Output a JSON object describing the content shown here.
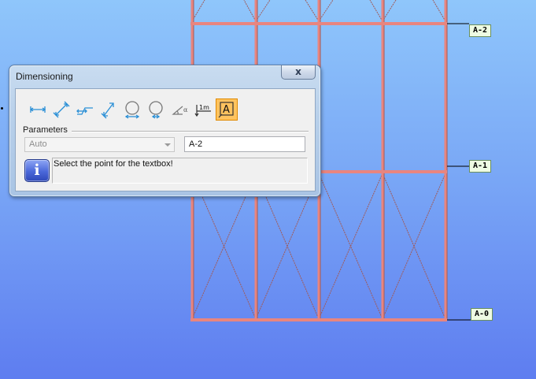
{
  "dialog": {
    "title": "Dimensioning",
    "close_label": "x",
    "toolbar": [
      {
        "icon": "linear-dimension-icon"
      },
      {
        "icon": "aligned-dimension-icon"
      },
      {
        "icon": "offset-dimension-icon"
      },
      {
        "icon": "angled-dimension-icon"
      },
      {
        "icon": "diameter-dimension-icon"
      },
      {
        "icon": "radius-dimension-icon"
      },
      {
        "icon": "angle-dimension-icon"
      },
      {
        "icon": "elevation-dimension-icon",
        "label": "1m"
      },
      {
        "icon": "text-dimension-icon",
        "label": "A",
        "active": true
      }
    ],
    "parameters_label": "Parameters",
    "mode_select": {
      "value": "Auto"
    },
    "text_input": {
      "value": "A-2"
    },
    "message": "Select the point for the textbox!",
    "info_glyph": "i"
  },
  "levels": [
    {
      "label": "A-2"
    },
    {
      "label": "A-1"
    },
    {
      "label": "A-0"
    }
  ],
  "colors": {
    "frame_member": "#e8857f",
    "frame_bracing": "#a05a58",
    "active_tool_bg": "#ffc35f",
    "background_top": "#8fc6fb",
    "background_bottom": "#5e7df0"
  }
}
